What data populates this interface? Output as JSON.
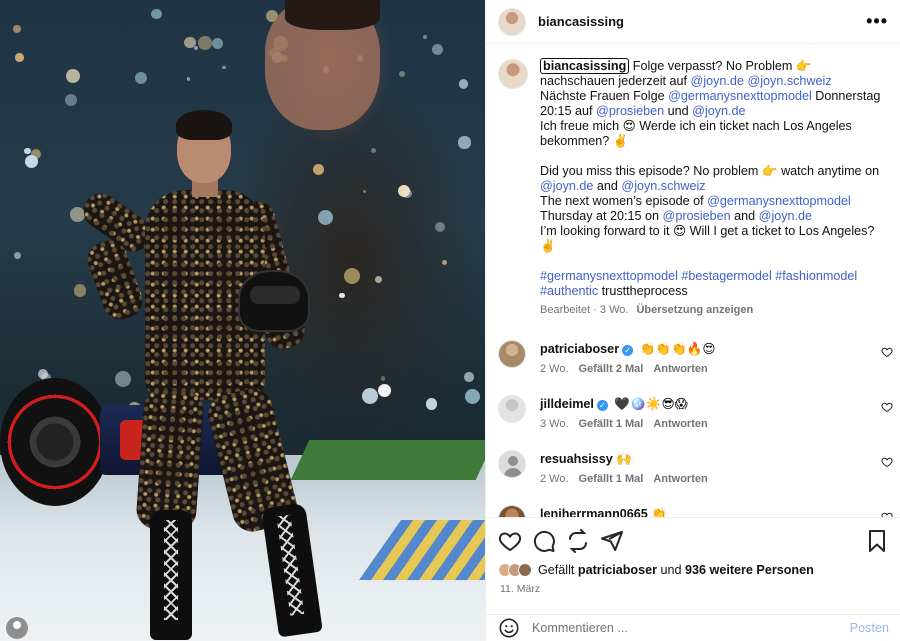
{
  "post": {
    "username": "biancasissing",
    "caption_user": "biancasissing",
    "caption": {
      "line1_a": " Folge verpasst? No Problem 👉 nachschauen jederzeit auf ",
      "m_joyn_de": "@joyn.de",
      "m_joyn_ch": "@joyn.schweiz",
      "line2_a": "Nächste Frauen Folge ",
      "m_gntm": "@germanysnexttopmodel",
      "line2_b": " Donnerstag 20:15 auf ",
      "m_prosieben": "@prosieben",
      "and_de": " und ",
      "line3": "Ich freue mich 😍 Werde ich ein ticket nach Los Angeles bekommen? ✌️",
      "en1_a": "Did you miss this episode? No problem 👉 watch anytime on ",
      "and_en": " and ",
      "en2_a": "The next women’s episode of ",
      "en2_b": "Thursday at 20:15 on ",
      "en3": "I’m looking forward to it 😍  Will I get a ticket to Los Angeles?✌️",
      "tags": [
        "#germanysnexttopmodel",
        "#bestagermodel",
        "#fashionmodel",
        "#authentic"
      ],
      "tag_plain": " trusttheprocess"
    },
    "caption_meta": {
      "edited": "Bearbeitet · 3 Wo.",
      "translate": "Übersetzung anzeigen"
    },
    "comments": [
      {
        "user": "patriciaboser",
        "verified": true,
        "text": "👏👏👏🔥😍",
        "age": "2 Wo.",
        "likes": "Gefällt 2 Mal",
        "reply": "Antworten"
      },
      {
        "user": "jilldeimel",
        "verified": true,
        "text": "🖤🪩☀️😎😱",
        "age": "3 Wo.",
        "likes": "Gefällt 1 Mal",
        "reply": "Antworten"
      },
      {
        "user": "resuahsissy",
        "verified": false,
        "text": "🙌",
        "age": "2 Wo.",
        "likes": "Gefällt 1 Mal",
        "reply": "Antworten"
      },
      {
        "user": "leniherrmann0665",
        "verified": false,
        "text": "👏",
        "age": "",
        "likes": "",
        "reply": ""
      }
    ],
    "likes": {
      "prefix": "Gefällt ",
      "user": "patriciaboser",
      "middle": " und ",
      "count": "936 weitere Personen"
    },
    "date": "11. März",
    "comment_placeholder": "Kommentieren ...",
    "post_label": "Posten"
  },
  "icons": {
    "more": "more-icon",
    "heart": "heart-icon",
    "comment": "comment-icon",
    "share": "share-icon",
    "bookmark": "bookmark-icon",
    "emoji": "emoji-icon"
  },
  "colors": {
    "link": "#3f62c9",
    "muted": "#737373",
    "verified": "#3897f0",
    "post_button": "#9ab5ee"
  }
}
